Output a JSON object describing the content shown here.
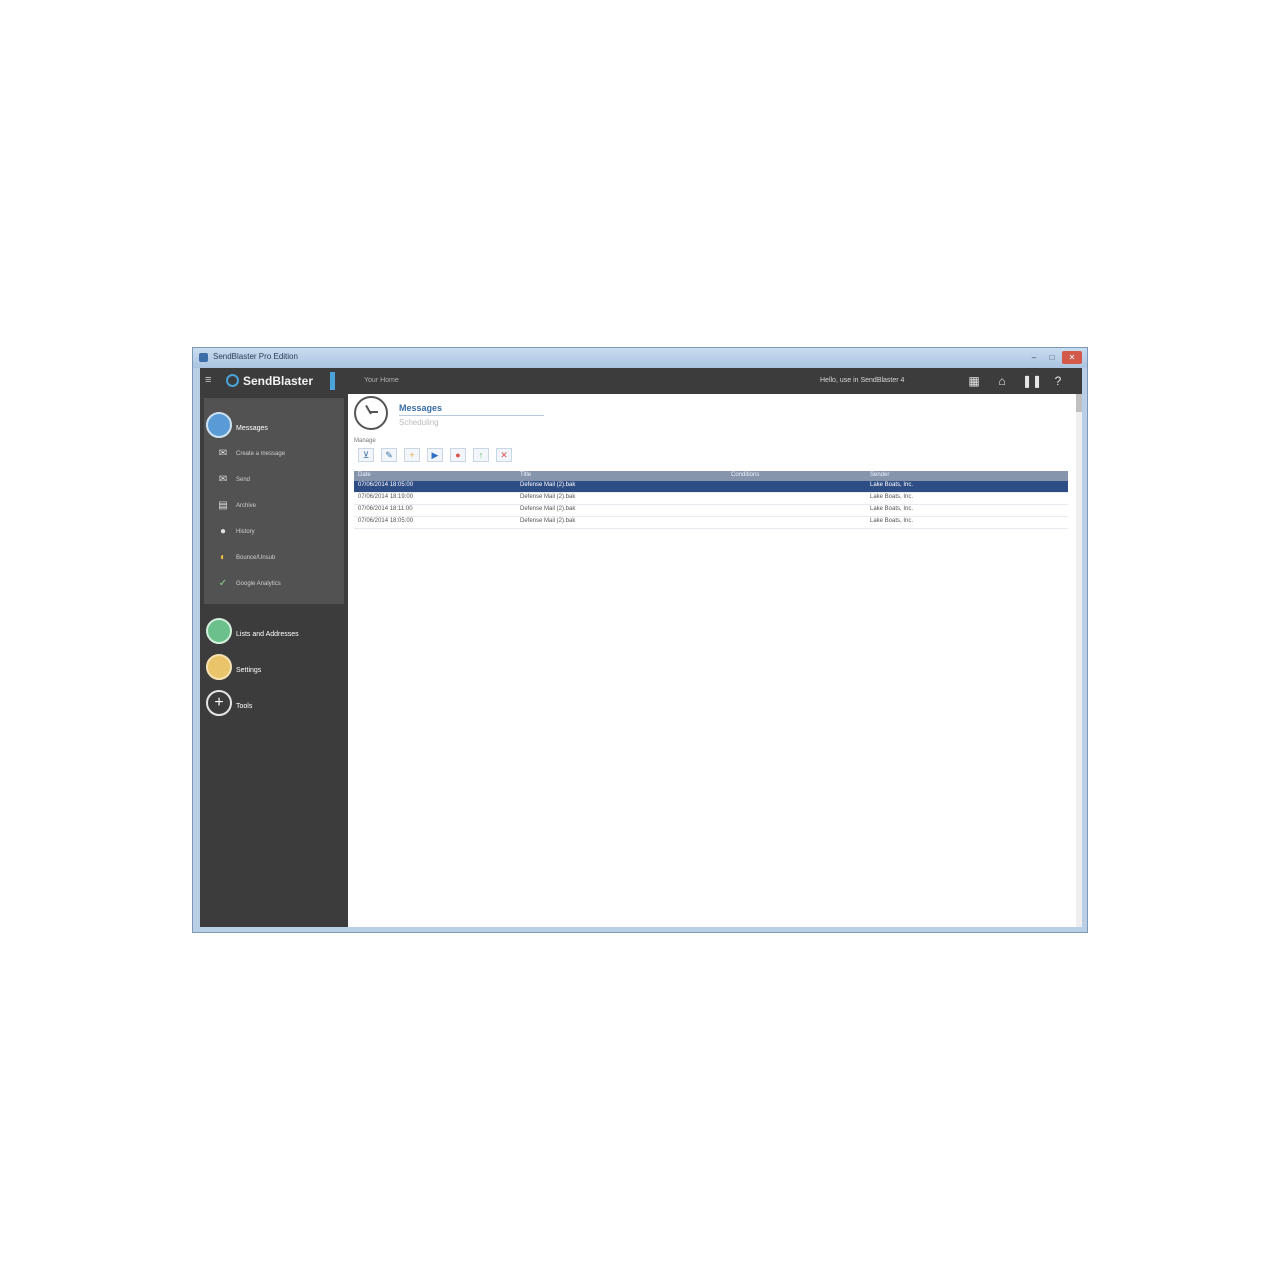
{
  "window": {
    "title": "SendBlaster Pro Edition",
    "controls": {
      "minimize": "–",
      "maximize": "□",
      "close": "✕"
    }
  },
  "topbar": {
    "menu_icon": "hamburger-icon",
    "brand": "SendBlaster",
    "breadcrumb": "Your Home",
    "user_text": "Hello, use in SendBlaster 4",
    "icons": [
      "calendar-icon",
      "home-icon",
      "pause-icon",
      "help-icon"
    ]
  },
  "sidebar": {
    "sections": [
      {
        "label": "Messages",
        "icon": "messages-icon",
        "color": "#5b9bd5"
      },
      {
        "label": "Lists and Addresses",
        "icon": "lists-icon",
        "color": "#6cc08b"
      },
      {
        "label": "Settings",
        "icon": "settings-icon",
        "color": "#e9c46a"
      },
      {
        "label": "Tools",
        "icon": "tools-icon",
        "color": "#3c3c3c"
      }
    ],
    "message_items": [
      {
        "label": "Create a message",
        "icon": "envelope-icon"
      },
      {
        "label": "Send",
        "icon": "send-icon"
      },
      {
        "label": "Archive",
        "icon": "archive-icon"
      },
      {
        "label": "History",
        "icon": "history-icon"
      },
      {
        "label": "Bounce/Unsub",
        "icon": "bounce-icon"
      },
      {
        "label": "Google Analytics",
        "icon": "analytics-icon"
      }
    ]
  },
  "page": {
    "title": "Messages",
    "subtitle": "Scheduling",
    "toolbar_label": "Manage",
    "toolbar_buttons": [
      {
        "name": "filter",
        "icon": "filter-icon",
        "glyph": "⊻",
        "color": "#3d6ea8"
      },
      {
        "name": "edit",
        "icon": "pencil-icon",
        "glyph": "✎",
        "color": "#3d6ea8"
      },
      {
        "name": "add",
        "icon": "plus-icon",
        "glyph": "+",
        "color": "#e8a33d"
      },
      {
        "name": "start",
        "icon": "play-icon",
        "glyph": "▶",
        "color": "#2f6fc4"
      },
      {
        "name": "stop",
        "icon": "stop-icon",
        "glyph": "●",
        "color": "#d9534f"
      },
      {
        "name": "move-up",
        "icon": "arrow-up-icon",
        "glyph": "↑",
        "color": "#5cb85c"
      },
      {
        "name": "delete",
        "icon": "delete-icon",
        "glyph": "✕",
        "color": "#d9534f"
      }
    ]
  },
  "table": {
    "columns": [
      "Date",
      "Title",
      "Conditions",
      "Sender"
    ],
    "rows": [
      [
        "07/06/2014 18:05:00",
        "Defense Mail (2).bak",
        "",
        "Lake Boats, Inc."
      ],
      [
        "07/06/2014 18:19:00",
        "Defense Mail (2).bak",
        "",
        "Lake Boats, Inc."
      ],
      [
        "07/06/2014 18:11:00",
        "Defense Mail (2).bak",
        "",
        "Lake Boats, Inc."
      ],
      [
        "07/06/2014 18:05:00",
        "Defense Mail (2).bak",
        "",
        "Lake Boats, Inc."
      ]
    ],
    "selected_index": 0
  }
}
